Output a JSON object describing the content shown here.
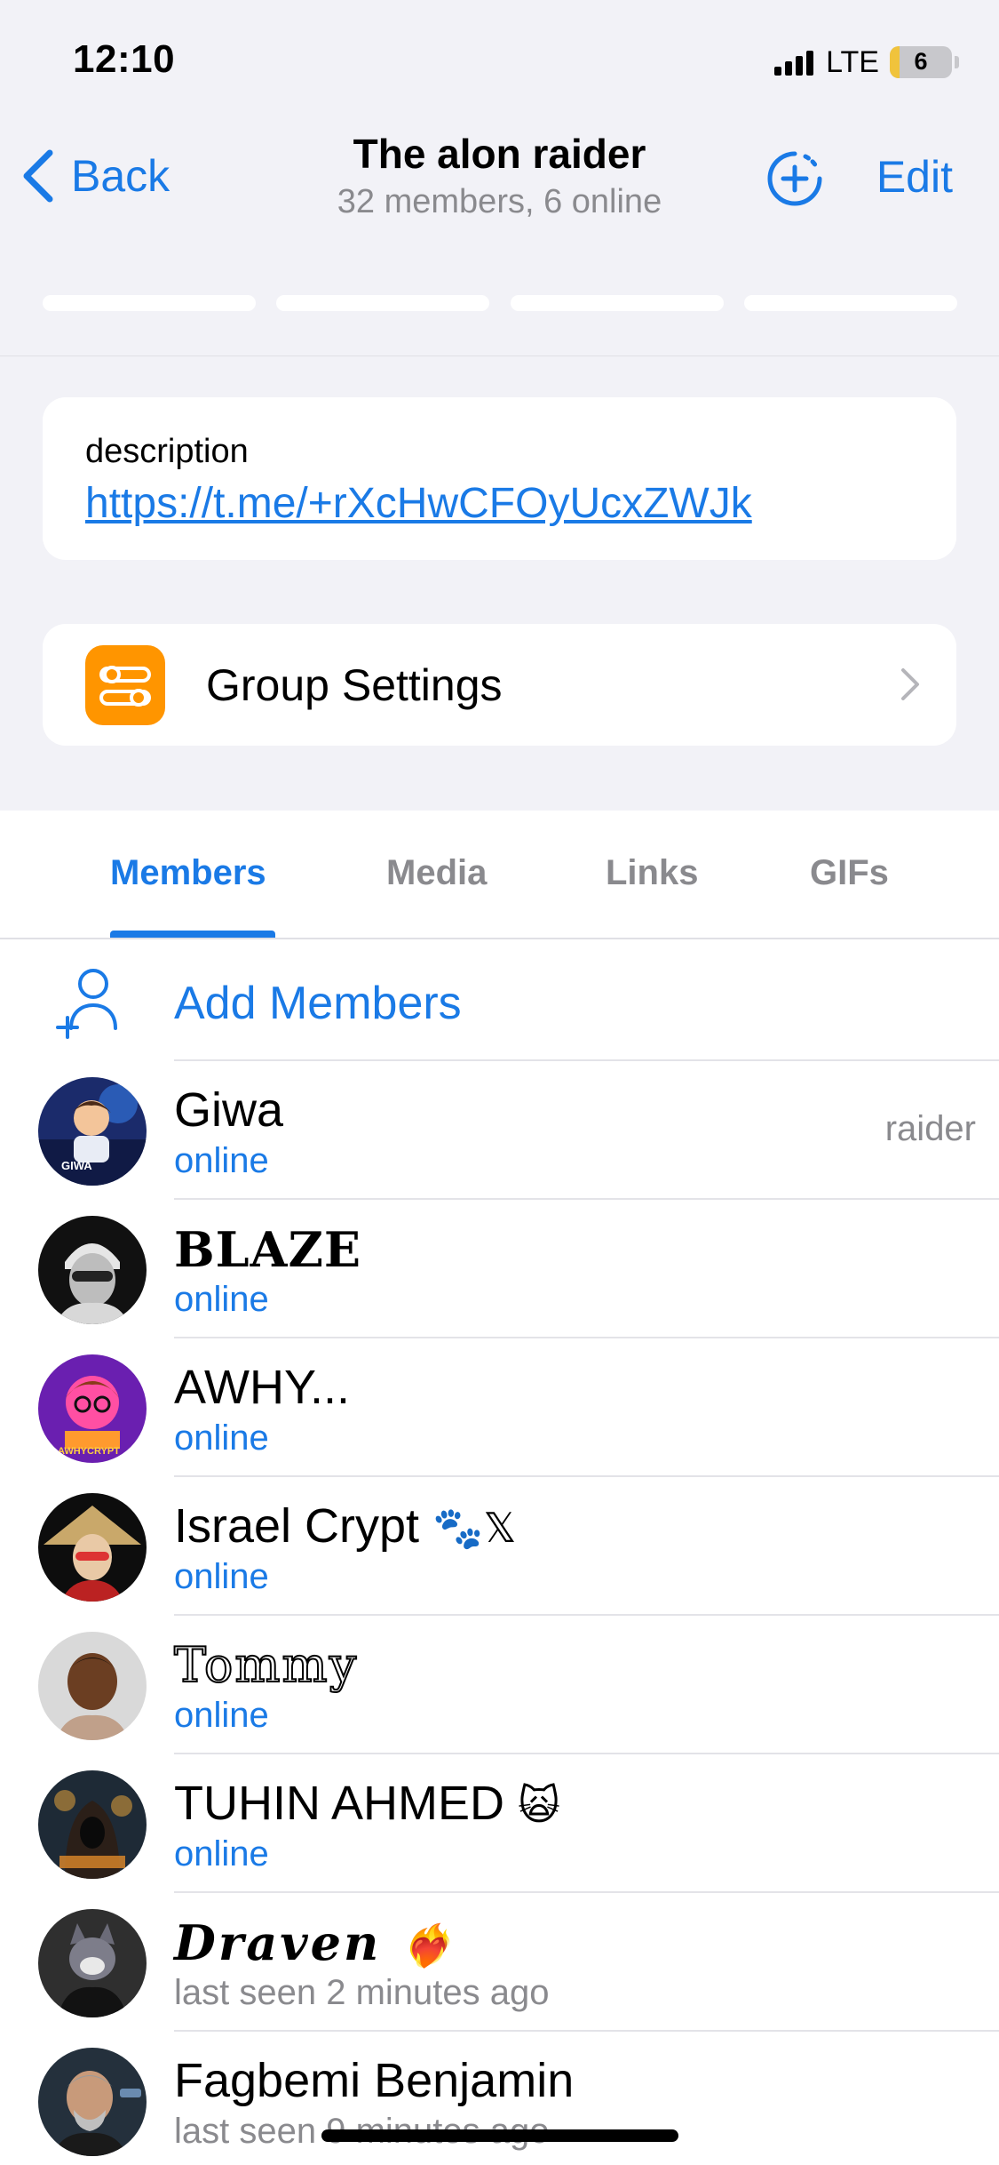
{
  "status_bar": {
    "time": "12:10",
    "network": "LTE",
    "battery": "6"
  },
  "nav": {
    "back_label": "Back",
    "title": "The alon raider",
    "subtitle": "32 members, 6 online",
    "edit_label": "Edit"
  },
  "description": {
    "label": "description",
    "link": "https://t.me/+rXcHwCFOyUcxZWJk"
  },
  "settings": {
    "label": "Group Settings",
    "icon_color": "#ff9500"
  },
  "tabs": [
    {
      "label": "Members",
      "active": true
    },
    {
      "label": "Media",
      "active": false
    },
    {
      "label": "Links",
      "active": false
    },
    {
      "label": "GIFs",
      "active": false
    }
  ],
  "add_members": {
    "label": "Add Members"
  },
  "members": [
    {
      "name": "Giwa",
      "status": "online",
      "role": "raider",
      "avatar_text": "GIWA"
    },
    {
      "name": "BLAZE",
      "status": "online"
    },
    {
      "name": "AWHY...",
      "status": "online",
      "avatar_text": "AWHYCRYPT"
    },
    {
      "name": "Israel Crypt",
      "name_suffix": "🐾𝕏",
      "status": "online"
    },
    {
      "name": "Tommy",
      "status": "online"
    },
    {
      "name": "TUHIN AHMED",
      "name_suffix": "🙀",
      "status": "online"
    },
    {
      "name": "Draven",
      "name_suffix": "❤️‍🔥",
      "status": "last seen 2 minutes ago"
    },
    {
      "name": "Fagbemi Benjamin",
      "status": "last seen 9 minutes ago"
    }
  ],
  "colors": {
    "accent": "#1a7ae6",
    "secondary_text": "#8a8a8e",
    "background": "#f2f2f7"
  }
}
